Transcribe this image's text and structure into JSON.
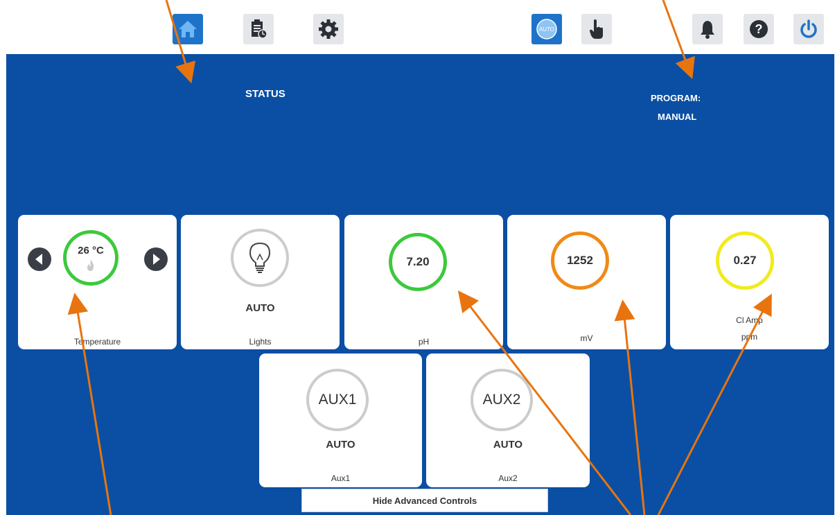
{
  "toolbar": {
    "buttons": [
      {
        "name": "home-icon",
        "active": true
      },
      {
        "name": "schedule-icon",
        "active": false
      },
      {
        "name": "gear-icon",
        "active": false
      },
      {
        "name": "auto-mode-icon",
        "active": true,
        "text": "AUTO"
      },
      {
        "name": "manual-hand-icon",
        "active": false
      },
      {
        "name": "bell-icon",
        "active": false
      },
      {
        "name": "help-icon",
        "active": false
      },
      {
        "name": "power-icon",
        "active": false
      }
    ]
  },
  "header": {
    "status_label": "STATUS",
    "program_label": "PROGRAM:",
    "program_value": "MANUAL"
  },
  "cards": {
    "temperature": {
      "value": "26 °C",
      "label": "Temperature",
      "ring_color": "#3cc93c"
    },
    "lights": {
      "state": "AUTO",
      "label": "Lights",
      "ring_color": "#cccccc"
    },
    "ph": {
      "value": "7.20",
      "label": "pH",
      "ring_color": "#3cc93c"
    },
    "mv": {
      "value": "1252",
      "label": "mV",
      "ring_color": "#f08a17"
    },
    "cl": {
      "value": "0.27",
      "label_line1": "Cl Amp",
      "label_line2": "ppm",
      "ring_color": "#f2ea1d"
    },
    "aux1": {
      "ring_text": "AUX1",
      "state": "AUTO",
      "label": "Aux1",
      "ring_color": "#cccccc"
    },
    "aux2": {
      "ring_text": "AUX2",
      "state": "AUTO",
      "label": "Aux2",
      "ring_color": "#cccccc"
    }
  },
  "hide_button": {
    "label": "Hide Advanced Controls"
  },
  "colors": {
    "background": "#0a4fa3",
    "accent": "#1e73c9",
    "annotation": "#e8740f"
  }
}
